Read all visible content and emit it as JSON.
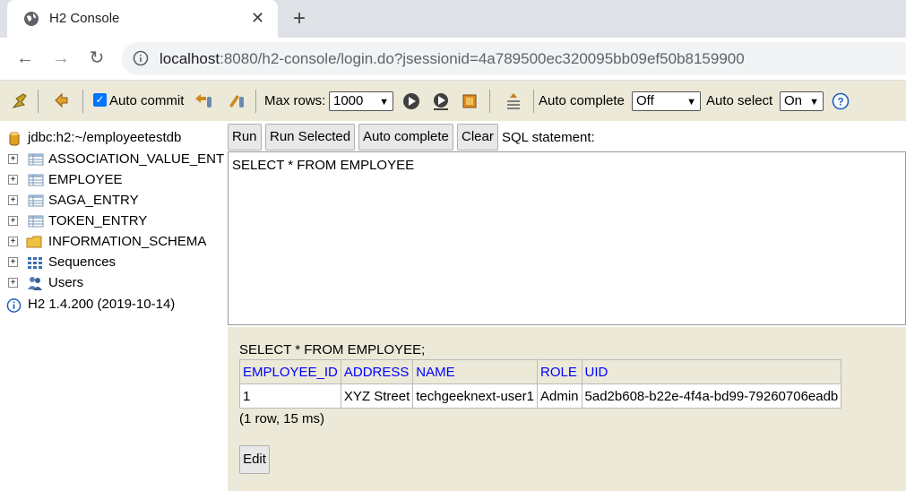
{
  "browser": {
    "tab_title": "H2 Console",
    "close_glyph": "✕",
    "newtab_glyph": "+",
    "url_host": "localhost",
    "url_rest": ":8080/h2-console/login.do?jsessionid=4a789500ec320095bb09ef50b8159900",
    "back_glyph": "←",
    "forward_glyph": "→",
    "reload_glyph": "↻"
  },
  "toolbar": {
    "auto_commit_label": "Auto commit",
    "max_rows_label": "Max rows:",
    "max_rows_value": "1000",
    "auto_complete_label": "Auto complete",
    "auto_complete_value": "Off",
    "auto_select_label": "Auto select",
    "auto_select_value": "On",
    "help_glyph": "?"
  },
  "tree": {
    "connection": "jdbc:h2:~/employeetestdb",
    "items": [
      {
        "label": "ASSOCIATION_VALUE_ENT",
        "icon": "table-icon"
      },
      {
        "label": "EMPLOYEE",
        "icon": "table-icon"
      },
      {
        "label": "SAGA_ENTRY",
        "icon": "table-icon"
      },
      {
        "label": "TOKEN_ENTRY",
        "icon": "table-icon"
      },
      {
        "label": "INFORMATION_SCHEMA",
        "icon": "folder-icon"
      },
      {
        "label": "Sequences",
        "icon": "sequences-icon"
      },
      {
        "label": "Users",
        "icon": "users-icon"
      }
    ],
    "version": "H2 1.4.200 (2019-10-14)"
  },
  "query": {
    "buttons": {
      "run": "Run",
      "run_selected": "Run Selected",
      "auto_complete": "Auto complete",
      "clear": "Clear"
    },
    "sql_label": "SQL statement:",
    "sql_text": "SELECT * FROM EMPLOYEE"
  },
  "result": {
    "query_echo": "SELECT * FROM EMPLOYEE;",
    "columns": [
      "EMPLOYEE_ID",
      "ADDRESS",
      "NAME",
      "ROLE",
      "UID"
    ],
    "rows": [
      [
        "1",
        "XYZ Street",
        "techgeeknext-user1",
        "Admin",
        "5ad2b608-b22e-4f4a-bd99-79260706eadb"
      ]
    ],
    "status": "(1 row, 15 ms)",
    "edit_label": "Edit"
  },
  "colors": {
    "panel_bg": "#ece9d8",
    "header_link": "#0000ff",
    "checkbox_accent": "#0075ff"
  }
}
